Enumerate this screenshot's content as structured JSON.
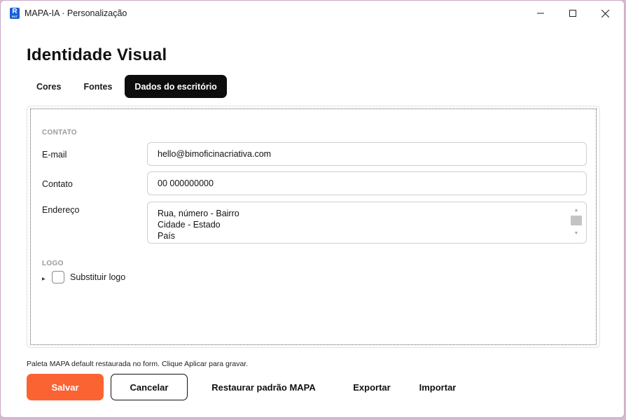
{
  "window": {
    "app_icon_letter": "R",
    "app_icon_sub": "RVT",
    "title": "MAPA-IA · Personalização"
  },
  "page": {
    "title": "Identidade Visual"
  },
  "tabs": [
    {
      "label": "Cores",
      "active": false
    },
    {
      "label": "Fontes",
      "active": false
    },
    {
      "label": "Dados do escritório",
      "active": true
    }
  ],
  "contact": {
    "section_label": "CONTATO",
    "email_label": "E-mail",
    "email_value": "hello@bimoficinacriativa.com",
    "phone_label": "Contato",
    "phone_value": "00 000000000",
    "address_label": "Endereço",
    "address_lines": [
      "Rua, número - Bairro",
      "Cidade - Estado",
      "País"
    ]
  },
  "logo": {
    "section_label": "LOGO",
    "replace_label": "Substituir logo",
    "replace_checked": false
  },
  "status_text": "Paleta MAPA default restaurada no form. Clique Aplicar para gravar.",
  "actions": {
    "save": "Salvar",
    "cancel": "Cancelar",
    "restore": "Restaurar padrão MAPA",
    "export": "Exportar",
    "import": "Importar"
  },
  "colors": {
    "accent": "#fb6333",
    "active_tab": "#0d0d0d"
  }
}
